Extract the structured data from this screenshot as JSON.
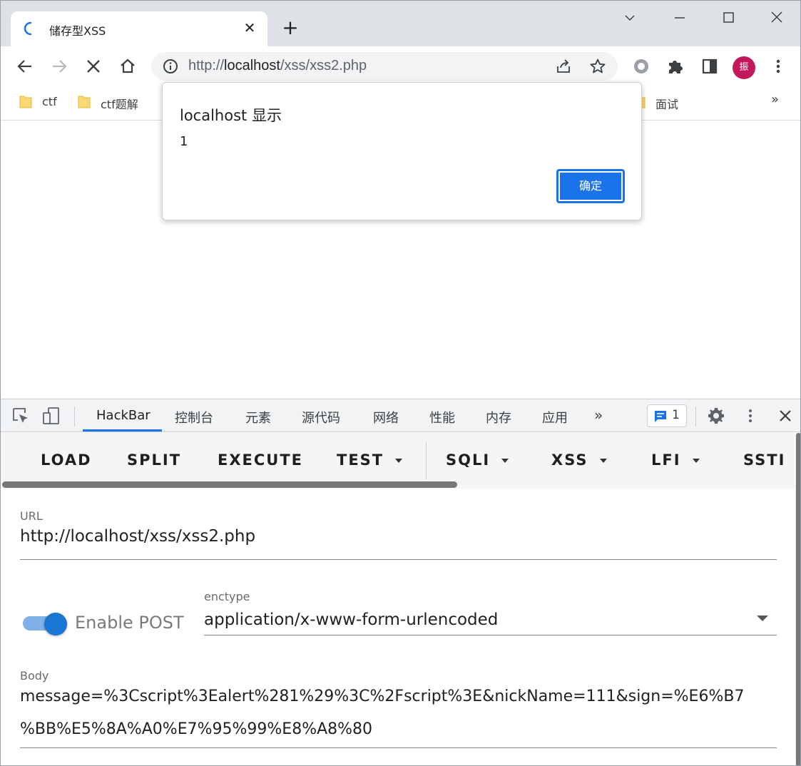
{
  "browser": {
    "tab_title": "储存型XSS",
    "url_prefix": "http://",
    "url_host": "localhost",
    "url_path": "/xss/xss2.php",
    "avatar_letter": "振"
  },
  "bookmarks": [
    {
      "label": "ctf"
    },
    {
      "label": "ctf题解"
    },
    {
      "label": "面试"
    }
  ],
  "alert": {
    "title": "localhost 显示",
    "message": "1",
    "ok_label": "确定"
  },
  "devtools": {
    "tabs": [
      "HackBar",
      "控制台",
      "元素",
      "源代码",
      "网络",
      "性能",
      "内存",
      "应用"
    ],
    "active_tab": "HackBar",
    "message_count": "1"
  },
  "hackbar": {
    "buttons": {
      "load": "LOAD",
      "split": "SPLIT",
      "execute": "EXECUTE",
      "test": "TEST",
      "sqli": "SQLI",
      "xss": "XSS",
      "lfi": "LFI",
      "ssti": "SSTI"
    },
    "url_label": "URL",
    "url_value": "http://localhost/xss/xss2.php",
    "enable_post_label": "Enable POST",
    "enable_post": true,
    "enctype_label": "enctype",
    "enctype_value": "application/x-www-form-urlencoded",
    "body_label": "Body",
    "body_line1": "message=%3Cscript%3Ealert%281%29%3C%2Fscript%3E&nickName=111&sign=%E6%B7",
    "body_line2": "%BB%E5%8A%A0%E7%95%99%E8%A8%80"
  },
  "colors": {
    "accent": "#1a73e8",
    "avatar": "#c2185b",
    "toggle": "#1976d2"
  }
}
